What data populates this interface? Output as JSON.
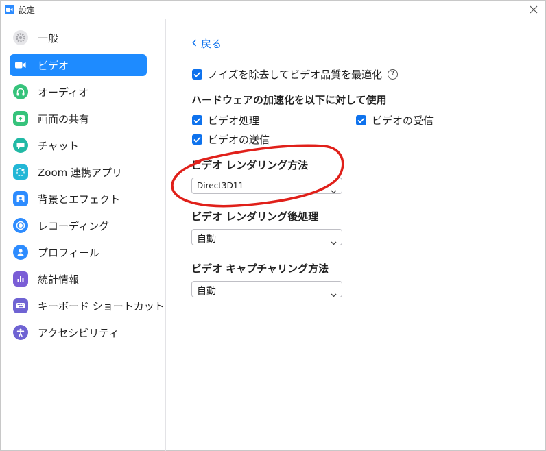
{
  "window": {
    "title": "設定"
  },
  "sidebar": {
    "items": [
      {
        "label": "一般",
        "icon": "gear-icon",
        "active": false,
        "color": "#e6e6e9"
      },
      {
        "label": "ビデオ",
        "icon": "video-camera-icon",
        "active": true,
        "color": "#ffffff"
      },
      {
        "label": "オーディオ",
        "icon": "headphones-icon",
        "active": false,
        "color": "#36c37b"
      },
      {
        "label": "画面の共有",
        "icon": "share-screen-icon",
        "active": false,
        "color": "#36c37b"
      },
      {
        "label": "チャット",
        "icon": "chat-bubble-icon",
        "active": false,
        "color": "#21b9a5"
      },
      {
        "label": "Zoom 連携アプリ",
        "icon": "apps-icon",
        "active": false,
        "color": "#23b7d6"
      },
      {
        "label": "背景とエフェクト",
        "icon": "background-icon",
        "active": false,
        "color": "#2d8cff"
      },
      {
        "label": "レコーディング",
        "icon": "record-icon",
        "active": false,
        "color": "#2d8cff"
      },
      {
        "label": "プロフィール",
        "icon": "profile-icon",
        "active": false,
        "color": "#2d8cff"
      },
      {
        "label": "統計情報",
        "icon": "statistics-icon",
        "active": false,
        "color": "#7a5dd6"
      },
      {
        "label": "キーボード ショートカット",
        "icon": "keyboard-icon",
        "active": false,
        "color": "#6f63d3"
      },
      {
        "label": "アクセシビリティ",
        "icon": "accessibility-icon",
        "active": false,
        "color": "#6f63d3"
      }
    ]
  },
  "main": {
    "back_label": "戻る",
    "noise_option": {
      "label": "ノイズを除去してビデオ品質を最適化",
      "checked": true
    },
    "hw_accel": {
      "title": "ハードウェアの加速化を以下に対して使用",
      "options": [
        {
          "label": "ビデオ処理",
          "checked": true
        },
        {
          "label": "ビデオの受信",
          "checked": true
        },
        {
          "label": "ビデオの送信",
          "checked": true
        }
      ]
    },
    "rendering_method": {
      "title": "ビデオ レンダリング方法",
      "value": "Direct3D11"
    },
    "rendering_post": {
      "title": "ビデオ レンダリング後処理",
      "value": "自動"
    },
    "capture_method": {
      "title": "ビデオ キャプチャリング方法",
      "value": "自動"
    }
  },
  "colors": {
    "accent": "#0e72ed",
    "active_nav": "#1e8bff",
    "annotation": "#e0201a"
  }
}
